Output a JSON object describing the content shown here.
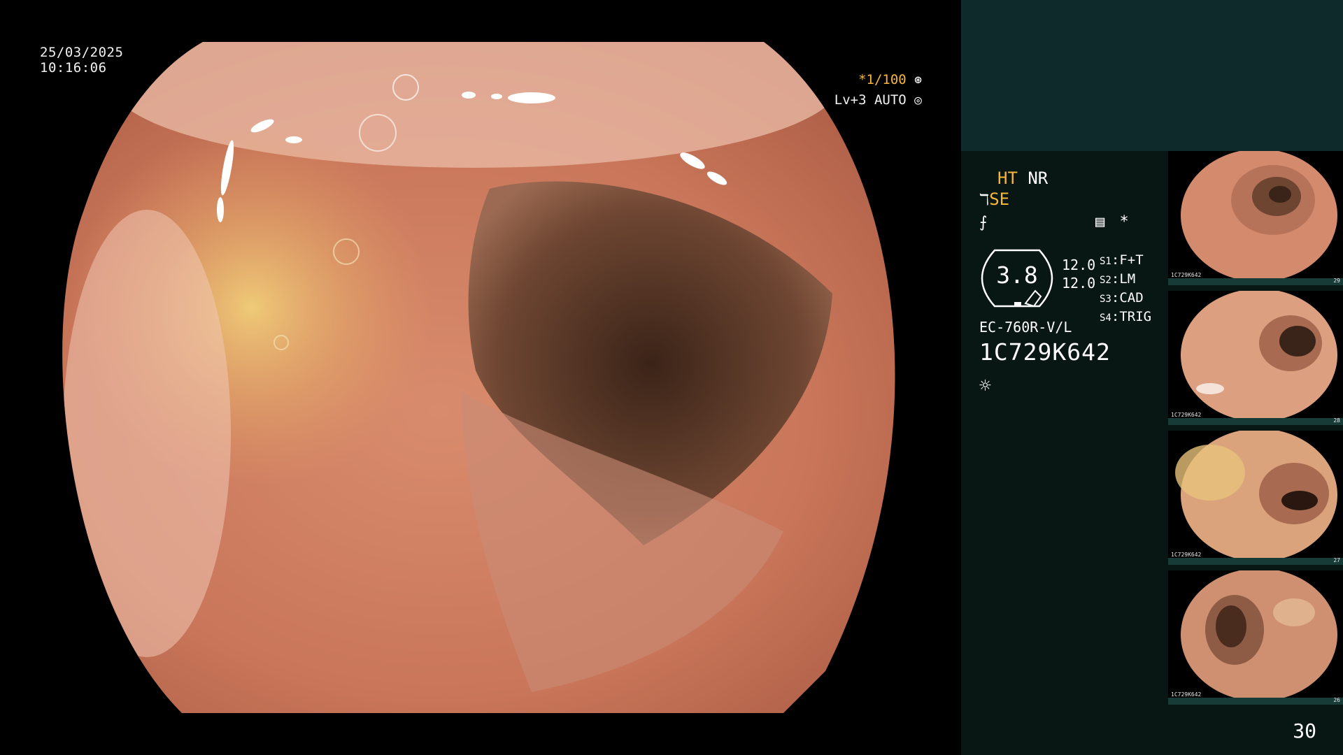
{
  "osd": {
    "date": "25/03/2025",
    "time": "10:16:06",
    "shutter": "*1/100",
    "shutter_icon": "aperture-icon",
    "level": "Lv+3 AUTO",
    "level_icon": "auto-iris-icon"
  },
  "panel": {
    "mode_ht": "HT",
    "mode_nr": "NR",
    "mode_se": "SE",
    "scope_value": "3.8",
    "param_1": "12.0",
    "param_2": "12.0",
    "switches": [
      {
        "key": "S1",
        "value": "F+T"
      },
      {
        "key": "S2",
        "value": "LM"
      },
      {
        "key": "S3",
        "value": "CAD"
      },
      {
        "key": "S4",
        "value": "TRIG"
      }
    ],
    "scope_model": "EC-760R-V/L",
    "scope_serial": "1C729K642",
    "star": "*",
    "colors": {
      "accent": "#f5b63a",
      "panel_bg": "#081614",
      "top_bar": "#0f2a2a"
    }
  },
  "thumbnails": [
    {
      "serial": "1C729K642",
      "number": "29"
    },
    {
      "serial": "1C729K642",
      "number": "28"
    },
    {
      "serial": "1C729K642",
      "number": "27"
    },
    {
      "serial": "1C729K642",
      "number": "26"
    }
  ],
  "page_number": "30"
}
